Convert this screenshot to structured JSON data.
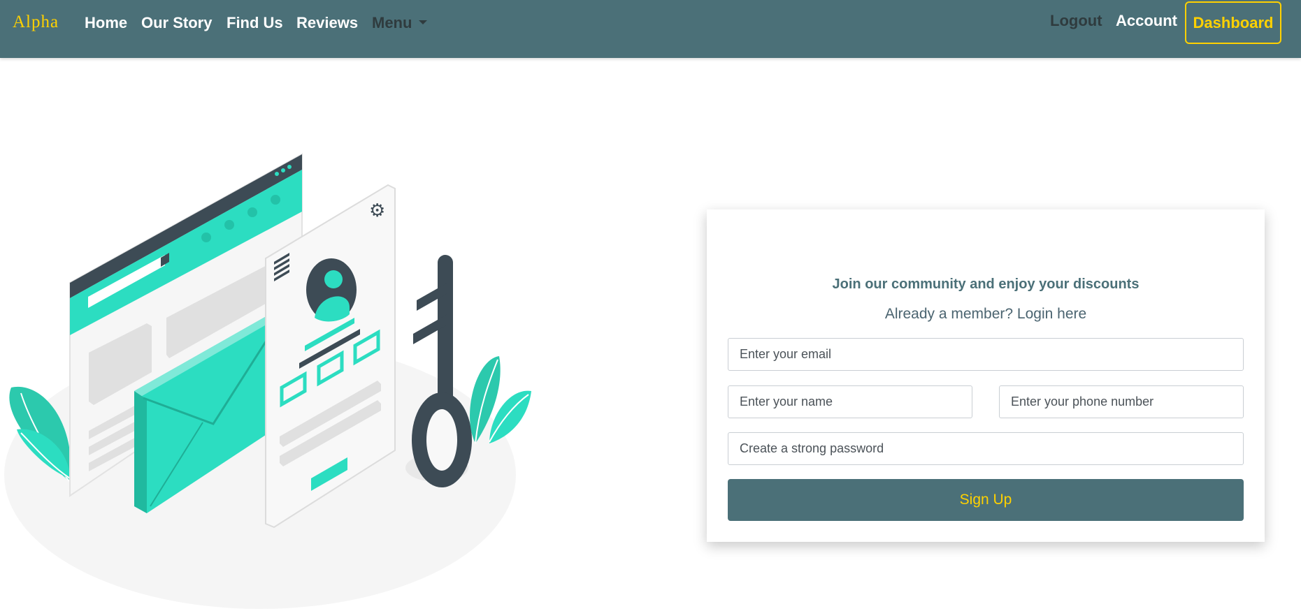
{
  "navbar": {
    "brand": "Alpha",
    "links": [
      "Home",
      "Our Story",
      "Find Us",
      "Reviews"
    ],
    "menu_label": "Menu",
    "logout_label": "Logout",
    "account_label": "Account",
    "dashboard_label": "Dashboard",
    "brand_color": "#ffd100",
    "bar_color": "#4b7078"
  },
  "signup": {
    "title": "Join our community and enjoy your discounts",
    "member_prompt": "Already a member? ",
    "login_link": "Login here",
    "email_placeholder": "Enter your email",
    "name_placeholder": "Enter your name",
    "phone_placeholder": "Enter your phone number",
    "password_placeholder": "Create a strong password",
    "submit_label": "Sign Up"
  },
  "illustration": {
    "subject": "isometric login illustration with browser window, envelope, profile card and key",
    "accent_color": "#2cddc1",
    "dark_color": "#3d4b55"
  }
}
